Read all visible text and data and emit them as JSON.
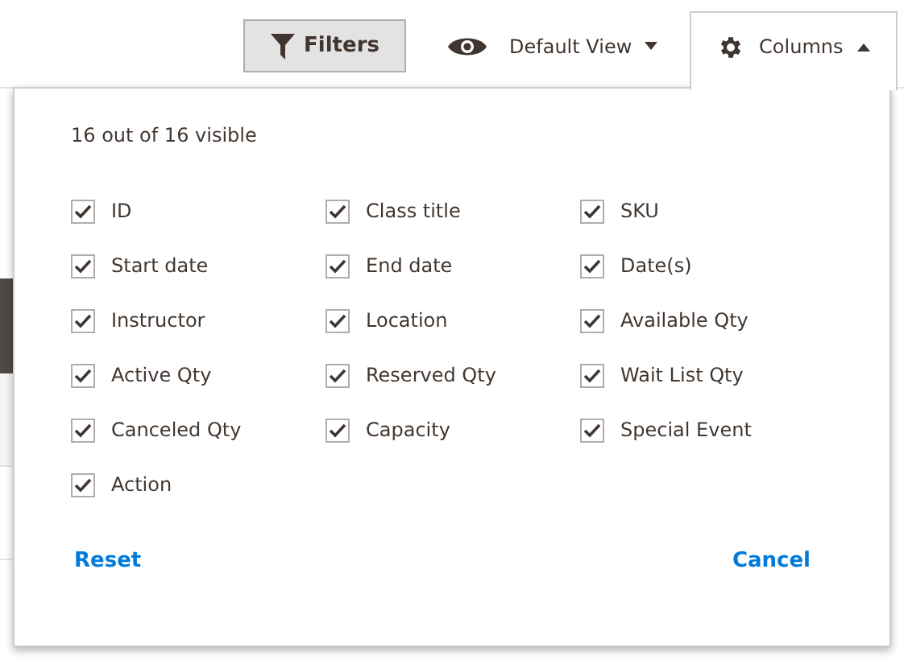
{
  "toolbar": {
    "filters_label": "Filters",
    "view_label": "Default View",
    "columns_label": "Columns",
    "columns_expanded": true
  },
  "columns_panel": {
    "summary": "16 out of 16 visible",
    "options": [
      {
        "label": "ID",
        "checked": true
      },
      {
        "label": "Class title",
        "checked": true
      },
      {
        "label": "SKU",
        "checked": true
      },
      {
        "label": "Start date",
        "checked": true
      },
      {
        "label": "End date",
        "checked": true
      },
      {
        "label": "Date(s)",
        "checked": true
      },
      {
        "label": "Instructor",
        "checked": true
      },
      {
        "label": "Location",
        "checked": true
      },
      {
        "label": "Available Qty",
        "checked": true
      },
      {
        "label": "Active Qty",
        "checked": true
      },
      {
        "label": "Reserved Qty",
        "checked": true
      },
      {
        "label": "Wait List Qty",
        "checked": true
      },
      {
        "label": "Canceled Qty",
        "checked": true
      },
      {
        "label": "Capacity",
        "checked": true
      },
      {
        "label": "Special Event",
        "checked": true
      },
      {
        "label": "Action",
        "checked": true
      }
    ],
    "reset_label": "Reset",
    "cancel_label": "Cancel"
  }
}
